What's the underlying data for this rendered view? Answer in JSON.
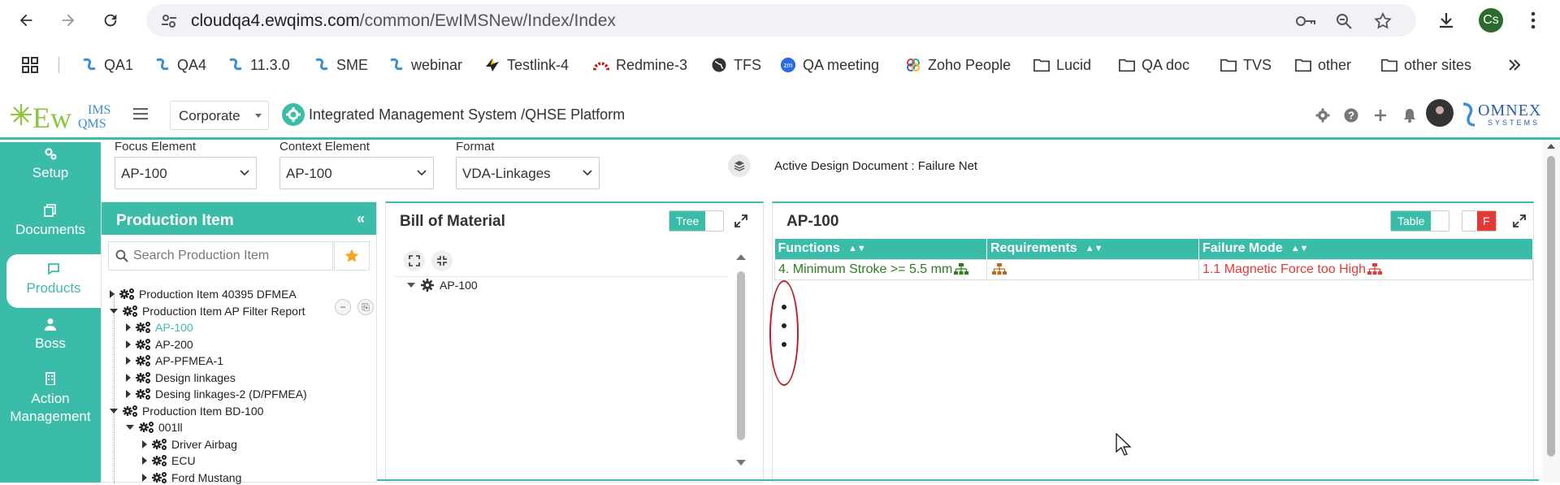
{
  "browser": {
    "url_host": "cloudqa4.ewqims.com",
    "url_path": "/common/EwIMSNew/Index/Index",
    "profile_initials": "Cs",
    "bookmarks": [
      {
        "label": "QA1",
        "icon": "ewqims-icon"
      },
      {
        "label": "QA4",
        "icon": "ewqims-icon"
      },
      {
        "label": "11.3.0",
        "icon": "ewqims-icon"
      },
      {
        "label": "SME",
        "icon": "ewqims-icon"
      },
      {
        "label": "webinar",
        "icon": "ewqims-icon"
      },
      {
        "label": "Testlink-4",
        "icon": "testlink-icon"
      },
      {
        "label": "Redmine-3",
        "icon": "redmine-icon"
      },
      {
        "label": "TFS",
        "icon": "globe-icon"
      },
      {
        "label": "QA meeting",
        "icon": "zoom-icon"
      },
      {
        "label": "Zoho People",
        "icon": "zoho-icon"
      },
      {
        "label": "Lucid",
        "icon": "folder-icon"
      },
      {
        "label": "QA doc",
        "icon": "folder-icon"
      },
      {
        "label": "TVS",
        "icon": "folder-icon"
      },
      {
        "label": "other",
        "icon": "folder-icon"
      },
      {
        "label": "other sites",
        "icon": "folder-icon"
      }
    ]
  },
  "header": {
    "logo_text": "EwQIMS",
    "org_select": "Corporate",
    "platform_title": "Integrated Management System /QHSE Platform",
    "brand": "OMNEX",
    "brand_sub": "SYSTEMS"
  },
  "leftnav": {
    "items": [
      {
        "label": "Setup",
        "icon": "gears-icon"
      },
      {
        "label": "Documents",
        "icon": "copy-icon"
      },
      {
        "label": "Products",
        "icon": "products-icon"
      },
      {
        "label": "Boss",
        "icon": "user-tie-icon"
      },
      {
        "label": "Action Management",
        "icon": "building-icon"
      }
    ],
    "active": "Products"
  },
  "filters": {
    "focus_label": "Focus Element",
    "focus_value": "AP-100",
    "context_label": "Context Element",
    "context_value": "AP-100",
    "format_label": "Format",
    "format_value": "VDA-Linkages",
    "active_doc": "Active Design Document : Failure Net"
  },
  "production_panel": {
    "title": "Production Item",
    "search_placeholder": "Search Production Item",
    "tree": [
      {
        "label": "Production Item 40395 DFMEA",
        "level": 0,
        "expanded": false
      },
      {
        "label": "Production Item AP Filter Report",
        "level": 0,
        "expanded": true
      },
      {
        "label": "AP-100",
        "level": 1,
        "expanded": false,
        "selected": true
      },
      {
        "label": "AP-200",
        "level": 1,
        "expanded": false
      },
      {
        "label": "AP-PFMEA-1",
        "level": 1,
        "expanded": false
      },
      {
        "label": "Design linkages",
        "level": 1,
        "expanded": false
      },
      {
        "label": "Desing linkages-2 (D/PFMEA)",
        "level": 1,
        "expanded": false
      },
      {
        "label": "Production Item BD-100",
        "level": 0,
        "expanded": true
      },
      {
        "label": "001ll",
        "level": 1,
        "expanded": true
      },
      {
        "label": "Driver Airbag",
        "level": 2,
        "expanded": false
      },
      {
        "label": "ECU",
        "level": 2,
        "expanded": false
      },
      {
        "label": "Ford Mustang",
        "level": 2,
        "expanded": false
      }
    ]
  },
  "bom_panel": {
    "title": "Bill of Material",
    "toggle_label": "Tree",
    "root_node": "AP-100"
  },
  "ap_panel": {
    "title": "AP-100",
    "toggle_label": "Table",
    "flag_label": "F",
    "columns": [
      "Functions",
      "Requirements",
      "Failure Mode"
    ],
    "row": {
      "function": "4. Minimum Stroke >= 5.5 mm",
      "requirement": "",
      "failure_mode": "1.1 Magnetic Force too High"
    }
  },
  "colors": {
    "accent": "#3bbca9",
    "function_green": "#2e7d1e",
    "failure_red": "#e53935",
    "req_orange": "#b86a1e"
  }
}
